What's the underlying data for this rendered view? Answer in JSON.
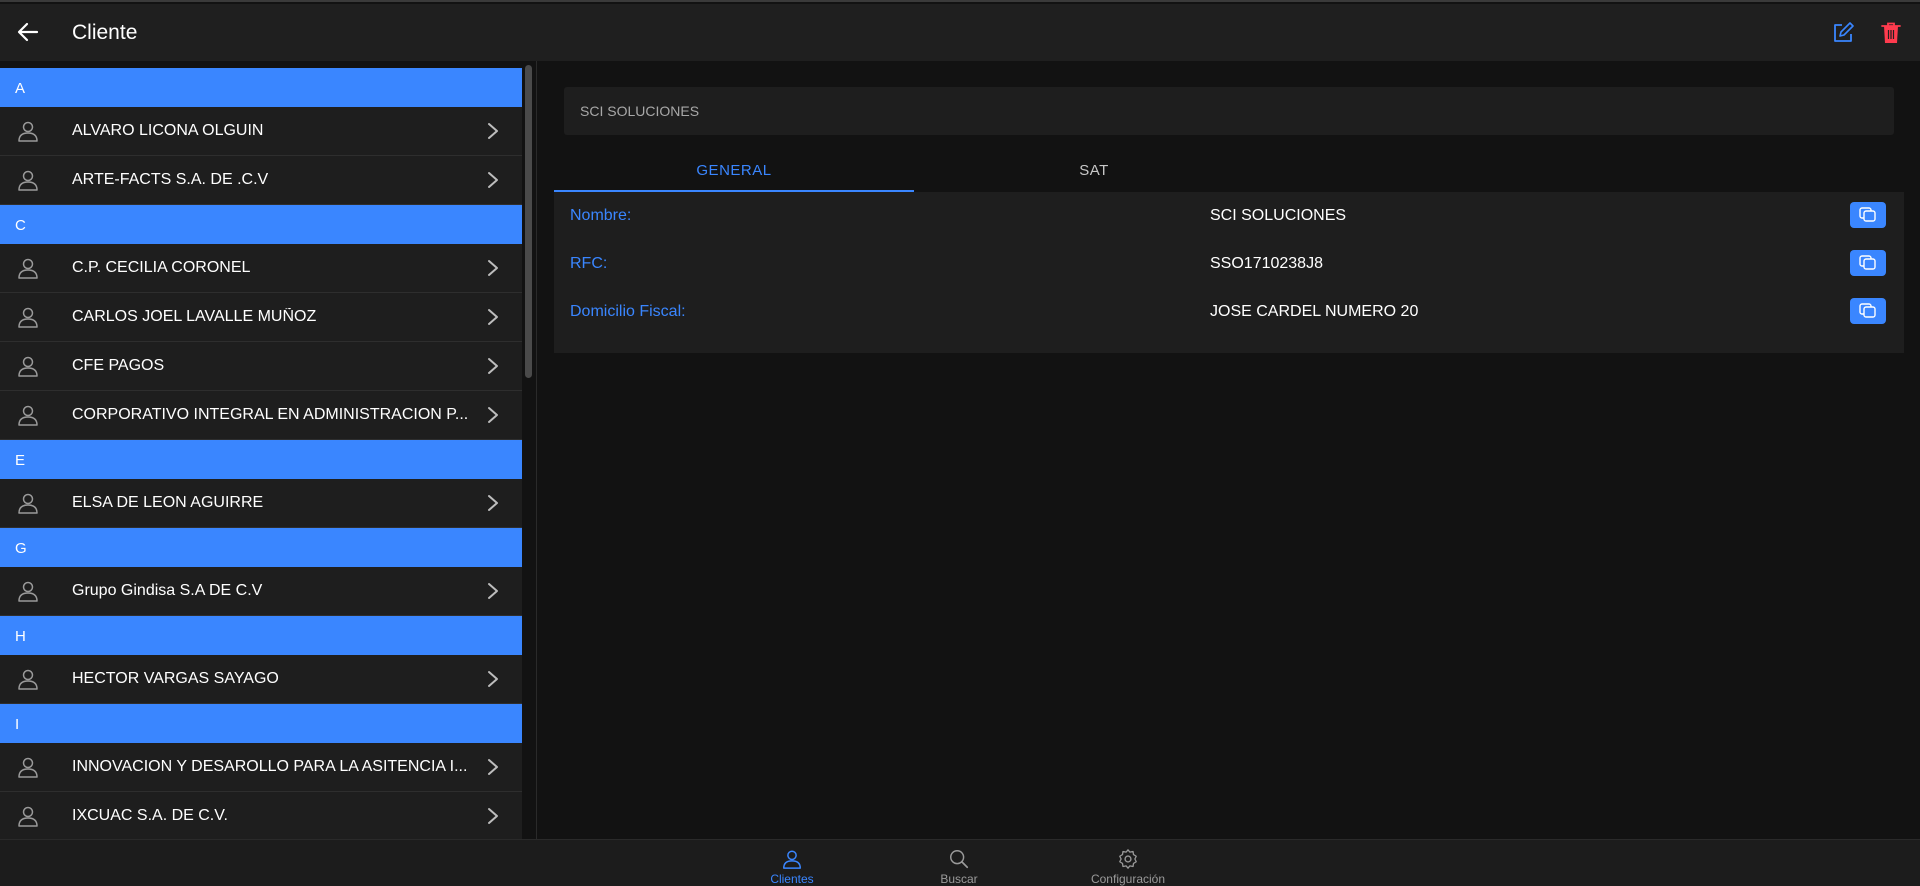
{
  "header": {
    "title": "Cliente",
    "back_icon": "arrow-left-icon",
    "edit_icon": "edit-icon",
    "delete_icon": "trash-icon"
  },
  "colors": {
    "accent": "#3a86ff",
    "danger": "#ff3b4e",
    "background": "#121212",
    "surface": "#1e1e1e"
  },
  "sidebar": {
    "sections": [
      {
        "letter": "A",
        "items": [
          {
            "name": "ALVARO LICONA OLGUIN"
          },
          {
            "name": "ARTE-FACTS S.A. DE .C.V"
          }
        ]
      },
      {
        "letter": "C",
        "items": [
          {
            "name": "C.P. CECILIA CORONEL"
          },
          {
            "name": "CARLOS JOEL LAVALLE MUÑOZ"
          },
          {
            "name": "CFE PAGOS"
          },
          {
            "name": "CORPORATIVO INTEGRAL EN ADMINISTRACION P..."
          }
        ]
      },
      {
        "letter": "E",
        "items": [
          {
            "name": "ELSA DE LEON AGUIRRE"
          }
        ]
      },
      {
        "letter": "G",
        "items": [
          {
            "name": "Grupo Gindisa S.A DE C.V"
          }
        ]
      },
      {
        "letter": "H",
        "items": [
          {
            "name": "HECTOR VARGAS SAYAGO"
          }
        ]
      },
      {
        "letter": "I",
        "items": [
          {
            "name": "INNOVACION Y DESAROLLO PARA LA ASITENCIA I..."
          },
          {
            "name": "IXCUAC S.A. DE C.V."
          }
        ]
      }
    ]
  },
  "main": {
    "search_value": "SCI SOLUCIONES",
    "tabs": [
      {
        "label": "GENERAL"
      },
      {
        "label": "SAT"
      }
    ],
    "active_tab": "GENERAL",
    "fields": [
      {
        "label": "Nombre:",
        "value": "SCI SOLUCIONES"
      },
      {
        "label": "RFC:",
        "value": "SSO1710238J8"
      },
      {
        "label": "Domicilio Fiscal:",
        "value": "JOSE CARDEL NUMERO 20"
      }
    ]
  },
  "bottom_nav": {
    "items": [
      {
        "label": "Clientes",
        "icon": "person-icon",
        "active": true
      },
      {
        "label": "Buscar",
        "icon": "search-icon",
        "active": false
      },
      {
        "label": "Configuración",
        "icon": "gear-icon",
        "active": false
      }
    ]
  }
}
